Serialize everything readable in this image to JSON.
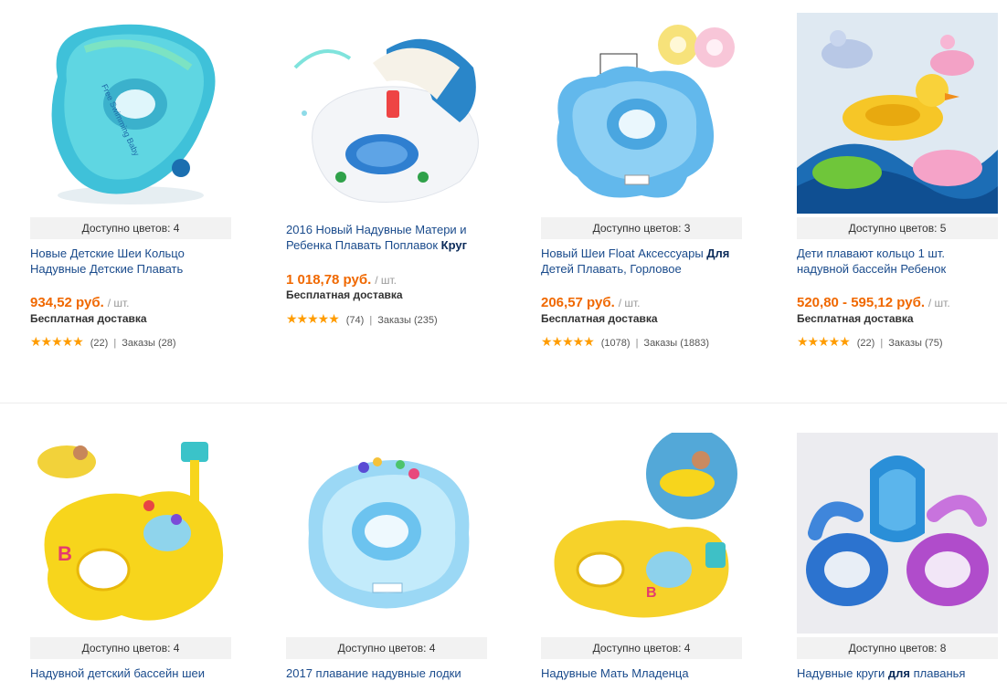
{
  "products": [
    {
      "colors": "Доступно цветов: 4",
      "title_pre": "Новые Детские Шеи Кольцо Надувные Детские Плавать",
      "title_bold": "",
      "title_post": "",
      "price": "934,52 руб.",
      "unit": "/ шт.",
      "shipping": "Бесплатная доставка",
      "reviews": "(22)",
      "orders": "Заказы (28)",
      "image": "neck-ring-green"
    },
    {
      "colors": "",
      "title_pre": "2016 Новый Надувные Матери и Ребенка Плавать Поплавок ",
      "title_bold": "Круг",
      "title_post": "",
      "price": "1 018,78 руб.",
      "unit": "/ шт.",
      "shipping": "Бесплатная доставка",
      "reviews": "(74)",
      "orders": "Заказы (235)",
      "image": "mother-baby-float-white"
    },
    {
      "colors": "Доступно цветов: 3",
      "title_pre": "Новый Шеи Float Аксессуары ",
      "title_bold": "Для",
      "title_post": " Детей Плавать, Горловое",
      "price": "206,57 руб.",
      "unit": "/ шт.",
      "shipping": "Бесплатная доставка",
      "reviews": "(1078)",
      "orders": "Заказы (1883)",
      "image": "neck-float-blue"
    },
    {
      "colors": "Доступно цветов: 5",
      "title_pre": "Дети плавают кольцо 1 шт. надувной бассейн Ребенок",
      "title_bold": "",
      "title_post": "",
      "price": "520,80 - 595,12 руб.",
      "unit": "/ шт.",
      "shipping": "Бесплатная доставка",
      "reviews": "(22)",
      "orders": "Заказы (75)",
      "image": "animal-floats"
    },
    {
      "colors": "Доступно цветов: 4",
      "title_pre": "Надувной детский бассейн шеи",
      "title_bold": "",
      "title_post": "",
      "image": "yellow-mother-baby-float"
    },
    {
      "colors": "Доступно цветов: 4",
      "title_pre": "2017 плавание надувные лодки",
      "title_bold": "",
      "title_post": "",
      "image": "neck-ring-clear-blue"
    },
    {
      "colors": "Доступно цветов: 4",
      "title_pre": "Надувные Мать Младенца",
      "title_bold": "",
      "title_post": "",
      "image": "yellow-float-pool"
    },
    {
      "colors": "Доступно цветов: 8",
      "title_pre": "Надувные круги ",
      "title_bold": "для",
      "title_post": " плаванья",
      "image": "swim-rings-blue-pink"
    }
  ],
  "colors": {
    "price": "#f06800",
    "link": "#1a4b8c",
    "star": "#ff9c00"
  }
}
